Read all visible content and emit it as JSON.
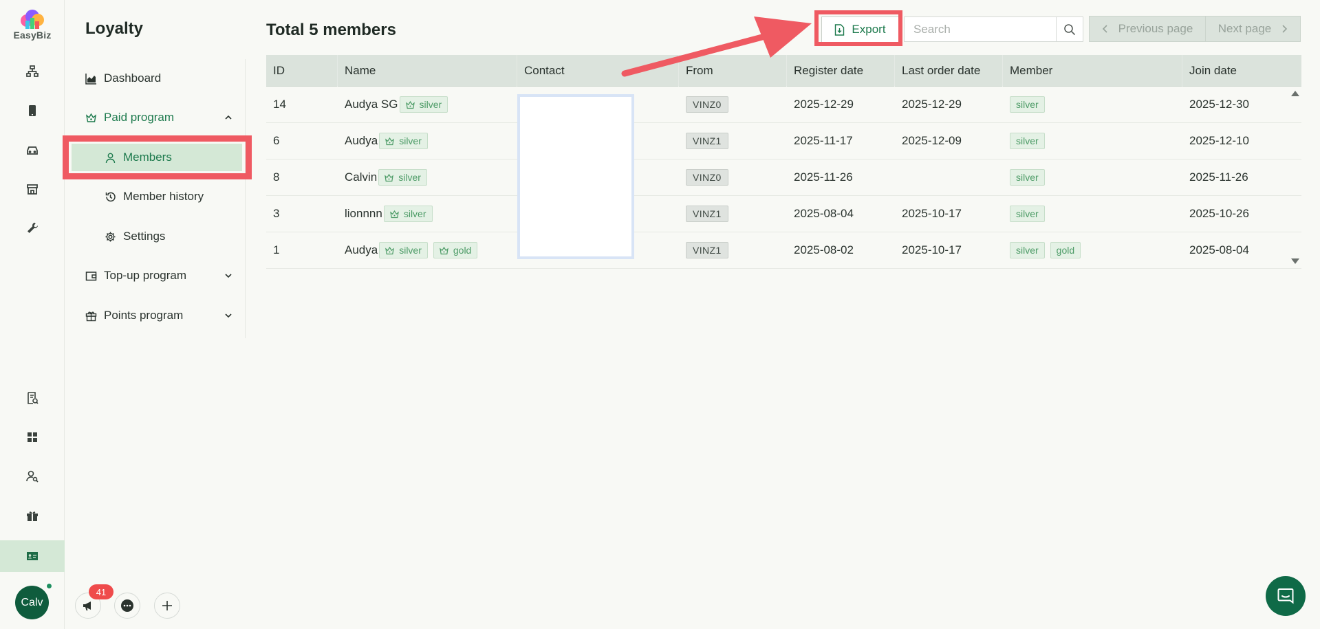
{
  "app": {
    "brand": "EasyBiz"
  },
  "user": {
    "avatar_text": "Calv"
  },
  "notifications": {
    "count": "41"
  },
  "sidebar": {
    "title": "Loyalty",
    "items": [
      {
        "label": "Dashboard",
        "icon": "chart-icon"
      },
      {
        "label": "Paid program",
        "icon": "crown-icon",
        "expanded": true
      },
      {
        "label": "Members",
        "icon": "user-icon",
        "active": true
      },
      {
        "label": "Member history",
        "icon": "history-icon"
      },
      {
        "label": "Settings",
        "icon": "gear-icon"
      },
      {
        "label": "Top-up program",
        "icon": "wallet-icon"
      },
      {
        "label": "Points program",
        "icon": "gift-icon"
      }
    ]
  },
  "header": {
    "title": "Total 5 members",
    "export_label": "Export",
    "search_placeholder": "Search",
    "prev_label": "Previous page",
    "next_label": "Next page"
  },
  "table": {
    "columns": [
      "ID",
      "Name",
      "Contact",
      "From",
      "Register date",
      "Last order date",
      "Member",
      "Join date"
    ],
    "rows": [
      {
        "id": "14",
        "name": "Audya SG",
        "name_tags": [
          "silver"
        ],
        "from": "VINZ0",
        "register": "2025-12-29",
        "last_order": "2025-12-29",
        "member": [
          "silver"
        ],
        "join": "2025-12-30"
      },
      {
        "id": "6",
        "name": "Audya",
        "name_tags": [
          "silver"
        ],
        "from": "VINZ1",
        "register": "2025-11-17",
        "last_order": "2025-12-09",
        "member": [
          "silver"
        ],
        "join": "2025-12-10"
      },
      {
        "id": "8",
        "name": "Calvin",
        "name_tags": [
          "silver"
        ],
        "from": "VINZ0",
        "register": "2025-11-26",
        "last_order": "",
        "member": [
          "silver"
        ],
        "join": "2025-11-26"
      },
      {
        "id": "3",
        "name": "lionnnn",
        "name_tags": [
          "silver"
        ],
        "from": "VINZ1",
        "register": "2025-08-04",
        "last_order": "2025-10-17",
        "member": [
          "silver"
        ],
        "join": "2025-10-26"
      },
      {
        "id": "1",
        "name": "Audya",
        "name_tags": [
          "silver",
          "gold"
        ],
        "from": "VINZ1",
        "register": "2025-08-02",
        "last_order": "2025-10-17",
        "member": [
          "silver",
          "gold"
        ],
        "join": "2025-08-04"
      }
    ]
  },
  "colors": {
    "accent": "#1d7a4d",
    "highlight": "#ef5a62",
    "active_bg": "#d4e8d6",
    "table_header_bg": "#dbe3dc"
  }
}
